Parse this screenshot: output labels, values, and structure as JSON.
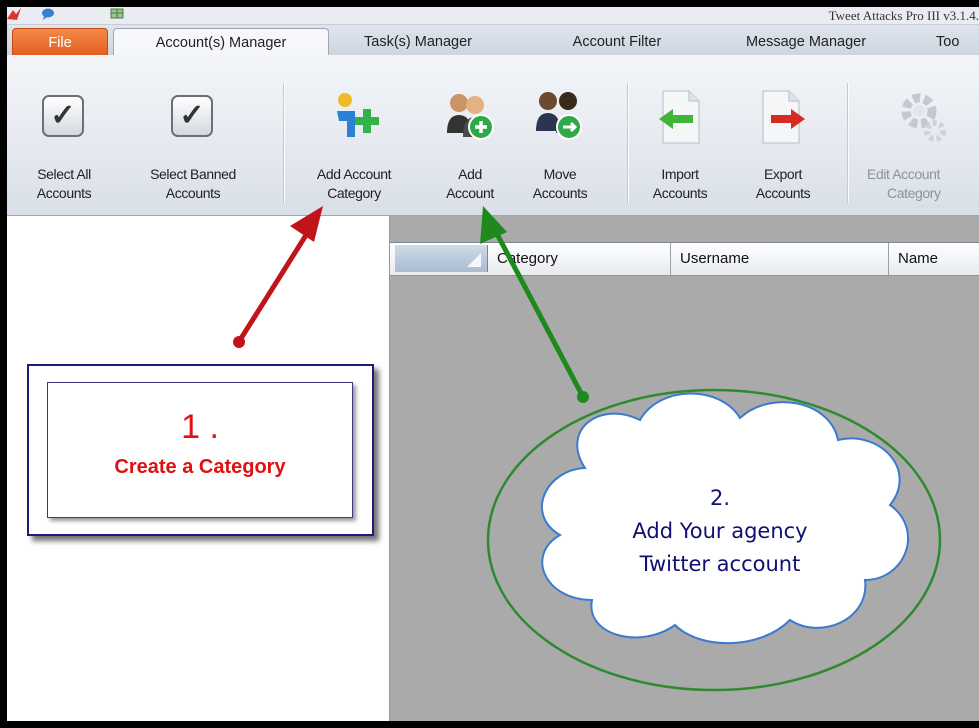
{
  "window": {
    "title": "Tweet Attacks Pro III v3.1.4."
  },
  "tabs": [
    {
      "label": "File"
    },
    {
      "label": "Account(s) Manager"
    },
    {
      "label": "Task(s) Manager"
    },
    {
      "label": "Account Filter"
    },
    {
      "label": "Message Manager"
    },
    {
      "label": "Too"
    }
  ],
  "ribbon": {
    "select_all": {
      "line1": "Select All",
      "line2": "Accounts"
    },
    "select_banned": {
      "line1": "Select Banned",
      "line2": "Accounts"
    },
    "add_category": {
      "line1": "Add Account",
      "line2": "Category"
    },
    "add_account": {
      "line1": "Add",
      "line2": "Account"
    },
    "move_accounts": {
      "line1": "Move",
      "line2": "Accounts"
    },
    "import_accounts": {
      "line1": "Import",
      "line2": "Accounts"
    },
    "export_accounts": {
      "line1": "Export",
      "line2": "Accounts"
    },
    "edit_category": {
      "line1": "Edit Account",
      "line2": "Category"
    }
  },
  "grid": {
    "columns": [
      "Category",
      "Username",
      "Name"
    ]
  },
  "annotations": {
    "step1_number": "1 .",
    "step1_text": "Create a Category",
    "step2_number": "2.",
    "step2_line1": "Add Your agency",
    "step2_line2": "Twitter account"
  },
  "colors": {
    "arrow_red": "#c0141a",
    "arrow_green": "#1e8a1e",
    "annotation_red": "#e01010",
    "cloud_text": "#101070",
    "file_tab": "#e45e1c"
  }
}
